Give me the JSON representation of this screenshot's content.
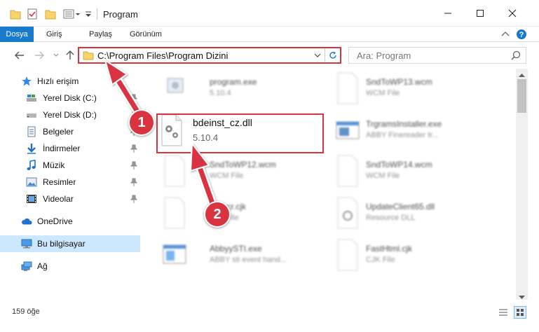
{
  "window": {
    "title": "Program"
  },
  "ribbon": {
    "tabs": [
      "Dosya",
      "Giriş",
      "Paylaş",
      "Görünüm"
    ]
  },
  "address": {
    "path": "C:\\Program Files\\Program Dizini"
  },
  "search": {
    "placeholder": "Ara: Program"
  },
  "sidebar": {
    "items": [
      {
        "label": "Hızlı erişim",
        "icon": "star-icon"
      },
      {
        "label": "Yerel Disk (C:)",
        "icon": "drive-icon",
        "pinned": true
      },
      {
        "label": "Yerel Disk (D:)",
        "icon": "drive-icon",
        "pinned": true
      },
      {
        "label": "Belgeler",
        "icon": "documents-icon",
        "pinned": true
      },
      {
        "label": "İndirmeler",
        "icon": "download-icon",
        "pinned": true
      },
      {
        "label": "Müzik",
        "icon": "music-icon",
        "pinned": true
      },
      {
        "label": "Resimler",
        "icon": "pictures-icon",
        "pinned": true
      },
      {
        "label": "Videolar",
        "icon": "videos-icon",
        "pinned": true
      },
      {
        "label": "OneDrive",
        "icon": "cloud-icon"
      },
      {
        "label": "Bu bilgisayar",
        "icon": "computer-icon",
        "selected": true
      },
      {
        "label": "Ağ",
        "icon": "network-icon"
      }
    ]
  },
  "files": {
    "focus": {
      "name": "bdeinst_cz.dll",
      "sub": "5.10.4"
    },
    "left": [
      {
        "name": "program.exe",
        "sub": "5.10.4"
      },
      {
        "name": "SndToWP12.wcm",
        "sub": "WCM File"
      },
      {
        "name": "Kmpcr.cjk",
        "sub": "CJK File"
      },
      {
        "name": "AbbyySTI.exe",
        "sub": "ABBY sti event hand..."
      }
    ],
    "right": [
      {
        "name": "SndToWP13.wcm",
        "sub": "WCM File"
      },
      {
        "name": "TrgramsInstaller.exe",
        "sub": "ABBY Finereader tr..."
      },
      {
        "name": "SndToWP14.wcm",
        "sub": "WCM File"
      },
      {
        "name": "UpdateClient65.dll",
        "sub": "Resource DLL"
      },
      {
        "name": "FastHtml.cjk",
        "sub": "CJK File"
      }
    ]
  },
  "status": {
    "count": "159 öğe"
  },
  "callouts": {
    "one": "1",
    "two": "2"
  },
  "colors": {
    "accent": "#1979ca",
    "highlight": "#d9333f",
    "selection": "#cce8ff"
  }
}
